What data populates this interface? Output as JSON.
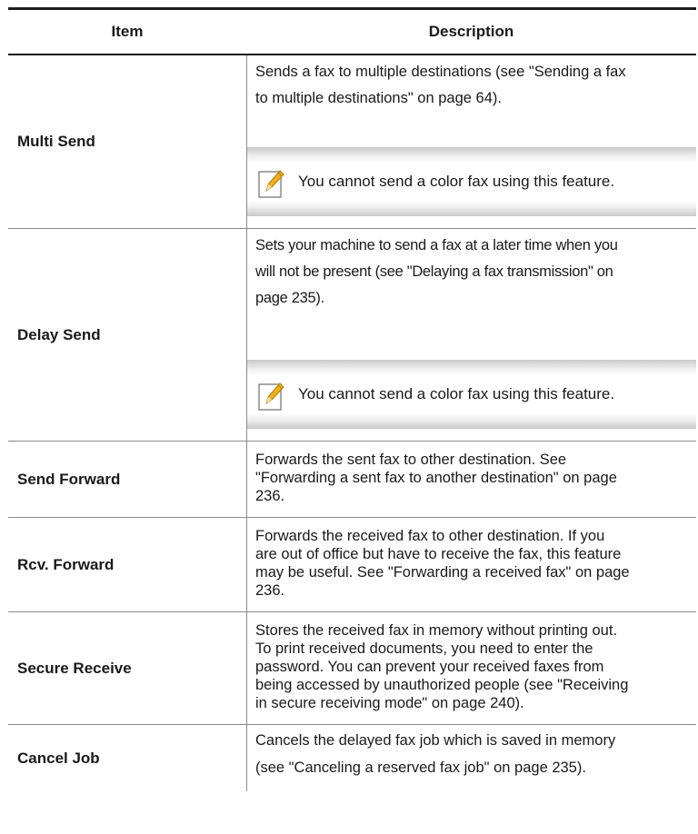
{
  "header": {
    "item": "Item",
    "description": "Description"
  },
  "rows": [
    {
      "item": "Multi Send",
      "desc": [
        "Sends a fax to multiple destinations (see \"Sending a fax",
        "to multiple destinations\" on page 64)."
      ],
      "note": "You cannot send a color fax using this feature."
    },
    {
      "item": "Delay Send",
      "desc": [
        "Sets your machine to send a fax at a later time when you",
        "will not be present (see \"Delaying a fax transmission\" on",
        "page 235)."
      ],
      "note": "You cannot send a color fax using this feature."
    },
    {
      "item": "Send Forward",
      "desc": [
        "Forwards the sent fax to other destination. See",
        "\"Forwarding a sent fax to another destination\" on page",
        "236."
      ]
    },
    {
      "item": "Rcv. Forward",
      "desc": [
        "Forwards the received fax to other destination. If you",
        "are out of office but have to receive the fax, this feature",
        "may be useful. See \"Forwarding a received fax\" on page",
        "236."
      ]
    },
    {
      "item": "Secure Receive",
      "desc": [
        "Stores the received fax in memory without printing out.",
        "To print received documents, you need to enter the",
        "password. You can prevent your received faxes from",
        "being accessed by unauthorized people (see \"Receiving",
        "in secure receiving mode\" on page 240)."
      ]
    },
    {
      "item": "Cancel Job",
      "desc": [
        "Cancels the delayed fax job which is saved in memory",
        "(see \"Canceling a reserved fax job\" on page 235)."
      ]
    }
  ]
}
